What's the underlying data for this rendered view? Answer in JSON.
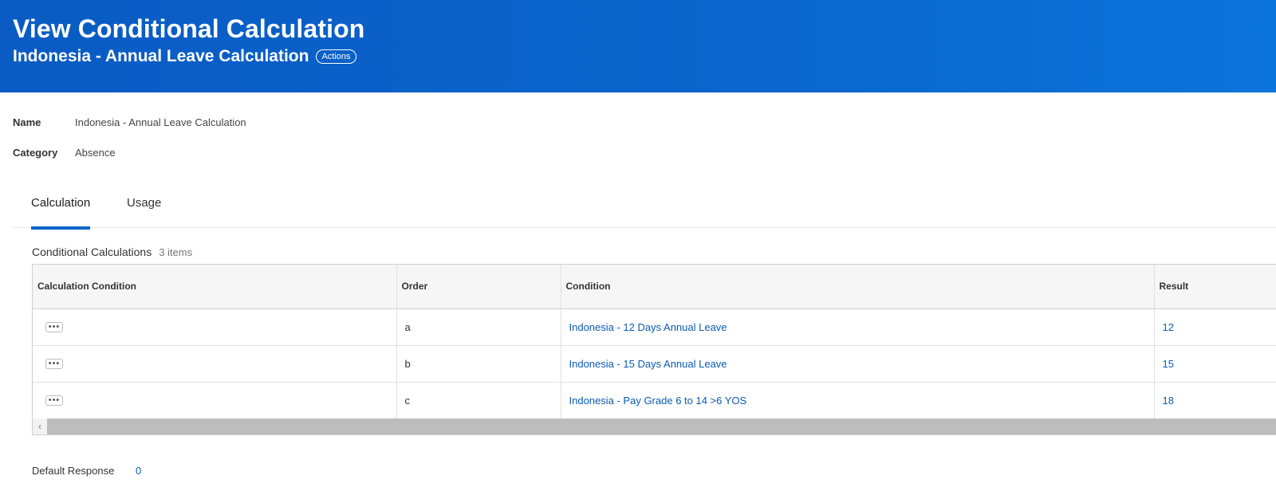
{
  "header": {
    "title": "View Conditional Calculation",
    "subtitle": "Indonesia - Annual Leave Calculation",
    "actions_label": "Actions"
  },
  "fields": {
    "name_label": "Name",
    "name_value": "Indonesia - Annual Leave Calculation",
    "category_label": "Category",
    "category_value": "Absence"
  },
  "tabs": [
    {
      "label": "Calculation",
      "active": true
    },
    {
      "label": "Usage",
      "active": false
    }
  ],
  "section": {
    "title": "Conditional Calculations",
    "count": "3 items"
  },
  "table": {
    "columns": [
      "Calculation Condition",
      "Order",
      "Condition",
      "Result"
    ],
    "rows": [
      {
        "order": "a",
        "condition": "Indonesia - 12 Days Annual Leave",
        "result": "12"
      },
      {
        "order": "b",
        "condition": "Indonesia - 15 Days Annual Leave",
        "result": "15"
      },
      {
        "order": "c",
        "condition": "Indonesia - Pay Grade 6 to 14 >6 YOS",
        "result": "18"
      }
    ],
    "related_actions_icon": "more-horizontal-icon",
    "scroll_left_icon": "chevron-left-icon"
  },
  "default_response": {
    "label": "Default Response",
    "value": "0"
  },
  "colors": {
    "header_bg": "#0a66cc",
    "link": "#0a5bb5",
    "tab_underline": "#0a66cc"
  }
}
